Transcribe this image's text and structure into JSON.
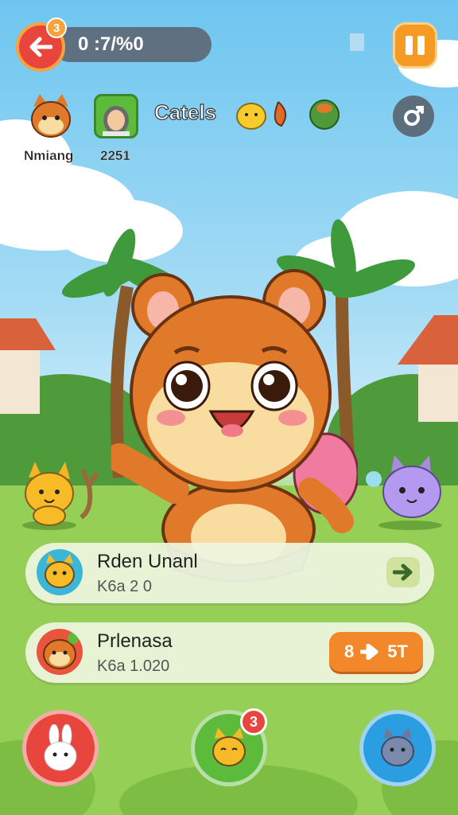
{
  "top_bar": {
    "back_badge": "3",
    "progress_text": "0 :7/%0"
  },
  "row2": {
    "player1_label": "Nmiang",
    "player2_label": "2251",
    "category_label": "Catels"
  },
  "cards": [
    {
      "title": "Rden Unanl",
      "subtitle": "K6a 2 0"
    },
    {
      "title": "Prlenasa",
      "subtitle": "K6a 1.020",
      "price_left": "8",
      "price_right": "5T"
    }
  ],
  "bottom_nav": {
    "badge": "3"
  },
  "colors": {
    "back_button": "#e8453c",
    "pause_button": "#f59a22",
    "price_button": "#f3882a",
    "nav_left": "#e8453c",
    "nav_center": "#5dbb3c",
    "nav_right": "#2a9ee0"
  },
  "icons": {
    "back": "arrow-left-icon",
    "pause": "pause-icon",
    "gender": "gender-icon",
    "go": "arrow-right-icon"
  }
}
